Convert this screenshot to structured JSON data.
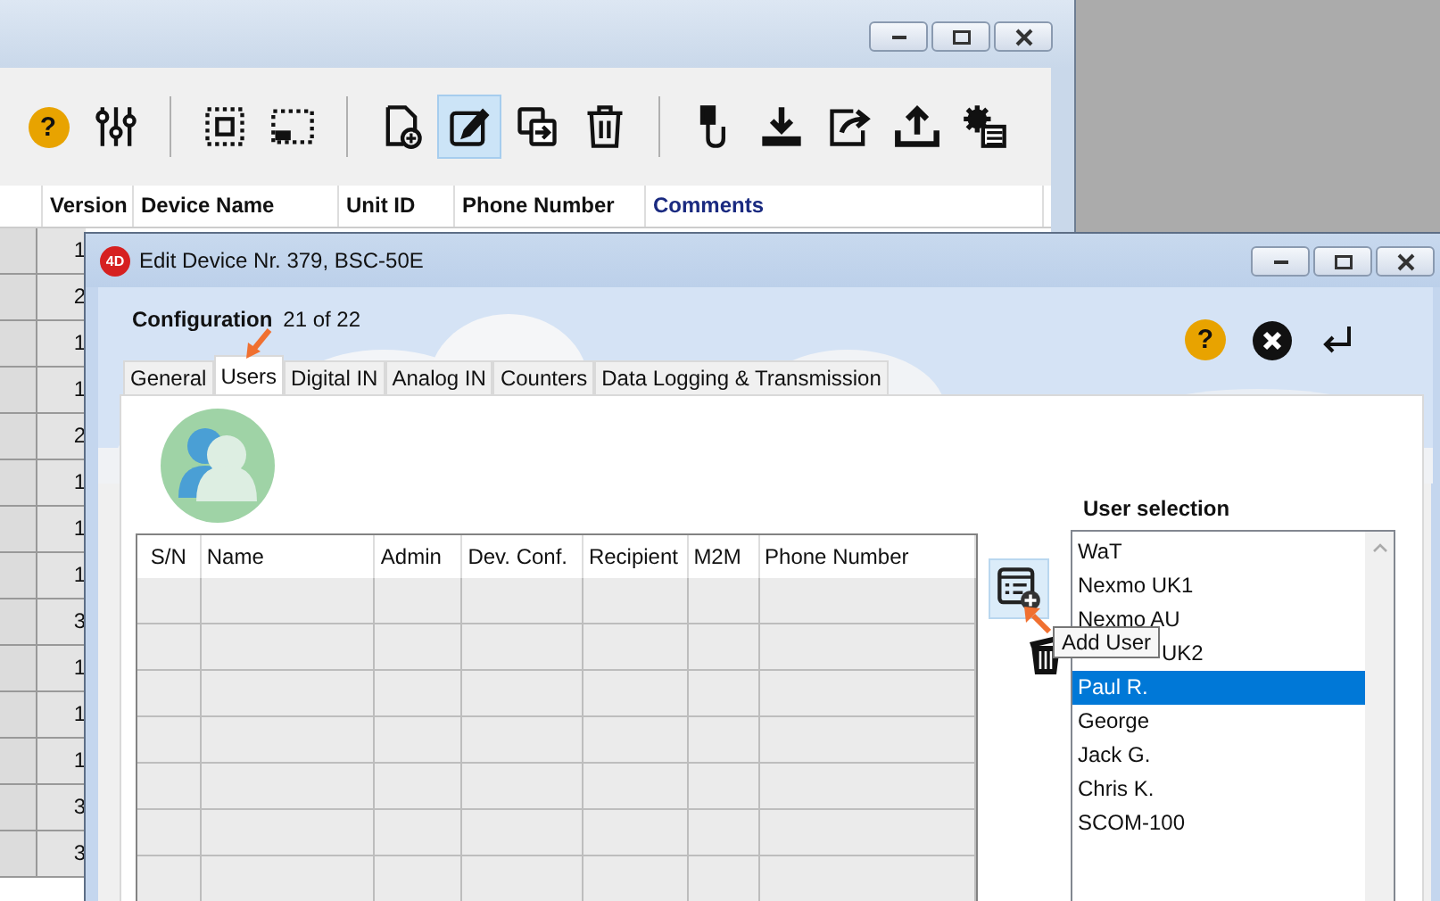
{
  "main_window": {
    "toolbar": [
      {
        "kind": "help",
        "glyph": "?",
        "selected": false
      },
      {
        "kind": "sliders",
        "selected": false
      },
      {
        "kind": "separator"
      },
      {
        "kind": "select-all",
        "selected": false
      },
      {
        "kind": "select-part",
        "selected": false
      },
      {
        "kind": "separator"
      },
      {
        "kind": "new-doc",
        "selected": false
      },
      {
        "kind": "edit",
        "selected": true
      },
      {
        "kind": "duplicate",
        "selected": false
      },
      {
        "kind": "trash",
        "selected": false
      },
      {
        "kind": "separator"
      },
      {
        "kind": "usb",
        "selected": false
      },
      {
        "kind": "download",
        "selected": false
      },
      {
        "kind": "share",
        "selected": false
      },
      {
        "kind": "upload",
        "selected": false
      },
      {
        "kind": "gear-list",
        "selected": false
      }
    ],
    "columns": [
      {
        "label": "Version",
        "highlighted": false
      },
      {
        "label": "Device Name",
        "highlighted": false
      },
      {
        "label": "Unit ID",
        "highlighted": false
      },
      {
        "label": "Phone Number",
        "highlighted": false
      },
      {
        "label": "Comments",
        "highlighted": true
      }
    ],
    "version_cells": [
      "1",
      "2",
      "1",
      "1",
      "2",
      "1",
      "1",
      "1",
      "3",
      "1",
      "1",
      "1",
      "3",
      "3"
    ]
  },
  "dialog": {
    "app_logo": "4D",
    "title": "Edit Device Nr. 379, BSC-50E",
    "configuration_label": "Configuration",
    "configuration_count": "21 of 22",
    "help_glyph": "?",
    "tabs": [
      {
        "label": "General",
        "selected": false
      },
      {
        "label": "Users",
        "selected": true
      },
      {
        "label": "Digital IN",
        "selected": false
      },
      {
        "label": "Analog IN",
        "selected": false
      },
      {
        "label": "Counters",
        "selected": false
      },
      {
        "label": "Data Logging & Transmission",
        "selected": false
      }
    ],
    "table": {
      "columns": [
        "S/N",
        "Name",
        "Admin",
        "Dev. Conf.",
        "Recipient",
        "M2M",
        "Phone Number"
      ]
    },
    "user_selection": {
      "title": "User selection",
      "items": [
        {
          "label": "WaT",
          "selected": false,
          "covered": false
        },
        {
          "label": "Nexmo UK1",
          "selected": false,
          "covered": false
        },
        {
          "label": "Nexmo AU",
          "selected": false,
          "covered": false
        },
        {
          "label": "UK2",
          "selected": false,
          "covered": true
        },
        {
          "label": "Paul R.",
          "selected": true,
          "covered": false
        },
        {
          "label": "George",
          "selected": false,
          "covered": false
        },
        {
          "label": "Jack G.",
          "selected": false,
          "covered": false
        },
        {
          "label": "Chris K.",
          "selected": false,
          "covered": false
        },
        {
          "label": "SCOM-100",
          "selected": false,
          "covered": false
        }
      ]
    },
    "tooltip": "Add User"
  }
}
